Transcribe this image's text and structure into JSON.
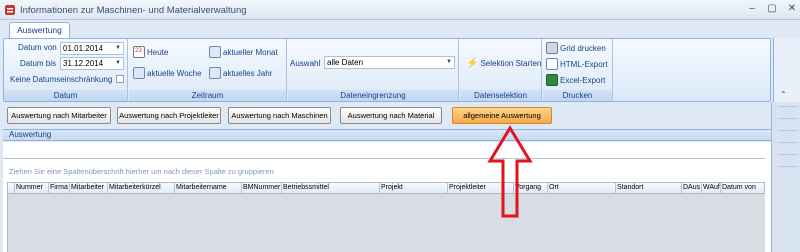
{
  "window": {
    "title": "Informationen zur Maschinen- und Materialverwaltung"
  },
  "ribbon": {
    "tab": "Auswertung",
    "datum": {
      "von_label": "Datum von",
      "von_value": "01.01.2014",
      "bis_label": "Datum bis",
      "bis_value": "31.12.2014",
      "keine_label": "Keine Datumseinschränkung",
      "group_label": "Datum"
    },
    "zeitraum": {
      "heute": "Heute",
      "aktuelle_woche": "aktuelle Woche",
      "aktueller_monat": "aktueller Monat",
      "aktuelles_jahr": "aktuelles Jahr",
      "group_label": "Zeitraum"
    },
    "daten": {
      "auswahl_label": "Auswahl",
      "auswahl_value": "alle Daten",
      "group_label": "Dateneingrenzung"
    },
    "selektion": {
      "start": "Selektion Starten",
      "group_label": "Datenselektion"
    },
    "drucken": {
      "grid": "Grid drucken",
      "html": "HTML-Export",
      "excel": "Excel-Export",
      "group_label": "Drucken"
    }
  },
  "buttons": [
    "Auswertung nach Mitarbeiter",
    "Auswertung nach Projektleiter",
    "Auswertung nach Maschinen",
    "Auswertung nach Material",
    "allgemeine Auswertung"
  ],
  "section": {
    "title": "Auswertung"
  },
  "grid": {
    "group_hint": "Ziehen Sie eine Spaltenüberschrift hierher um nach dieser Spalte zu gruppieren",
    "columns": [
      "Nummer",
      "Firma",
      "Mitarbeiter",
      "Mitarbeiterkürzel",
      "Mitarbeitername",
      "BMNummer",
      "Betriebssmittel",
      "Projekt",
      "Projektleiter",
      "Vorgang",
      "Ort",
      "Standort",
      "DAus",
      "WAuf",
      "Datum von"
    ]
  },
  "colors": {
    "active_button": "#f7a94a",
    "annotation_arrow": "#e0141e"
  }
}
